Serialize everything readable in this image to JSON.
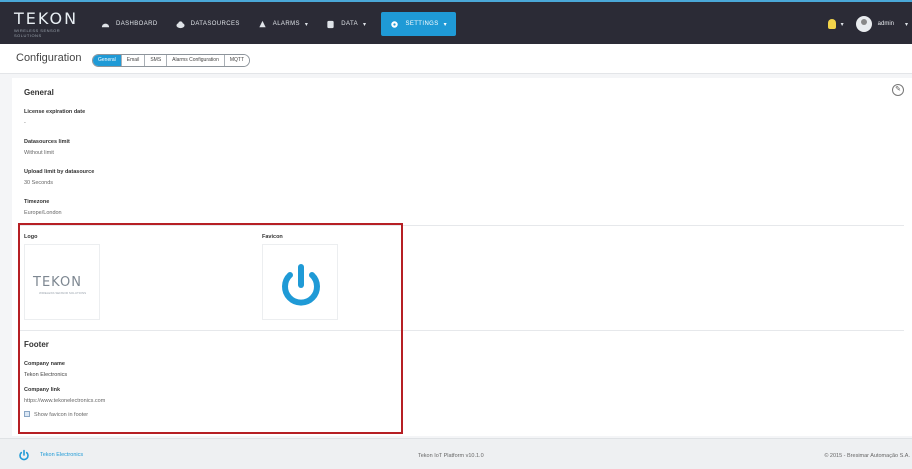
{
  "brand": {
    "name": "TEKON",
    "tagline": "WIRELESS SENSOR SOLUTIONS"
  },
  "nav": {
    "items": [
      {
        "label": "DASHBOARD",
        "icon": "dashboard-icon"
      },
      {
        "label": "DATASOURCES",
        "icon": "cloud-icon"
      },
      {
        "label": "ALARMS",
        "icon": "bell-icon"
      },
      {
        "label": "DATA",
        "icon": "database-icon"
      }
    ],
    "active": {
      "label": "SETTINGS",
      "icon": "gear-icon"
    }
  },
  "user": {
    "name": "admin",
    "icon": "lightbulb-icon"
  },
  "page": {
    "title": "Configuration",
    "tabs": [
      "General",
      "Email",
      "SMS",
      "Alarms Configuration",
      "MQTT"
    ],
    "active_tab": "General"
  },
  "general": {
    "title": "General",
    "fields": [
      {
        "label": "License expiration date",
        "value": "-"
      },
      {
        "label": "Datasources limit",
        "value": "Without limit"
      },
      {
        "label": "Upload limit by datasource",
        "value": "30 Seconds"
      },
      {
        "label": "Timezone",
        "value": "Europe/London"
      }
    ]
  },
  "images": {
    "logo_label": "Logo",
    "favicon_label": "Favicon",
    "logo_word": "TEKON",
    "logo_tagline": "WIRELESS SENSOR SOLUTIONS"
  },
  "footer_section": {
    "title": "Footer",
    "company_name_label": "Company name",
    "company_name": "Tekon Electronics",
    "company_link_label": "Company link",
    "company_link": "https://www.tekonelectronics.com",
    "checkbox_label": "Show favicon in footer"
  },
  "footer": {
    "left_link": "Tekon Electronics",
    "center": "Tekon IoT Platform v10.1.0",
    "right": "© 2015 - Bresimar Automação S.A."
  },
  "colors": {
    "accent": "#1f9ad6",
    "navbar": "#2b2b36",
    "highlight": "#b61f24"
  }
}
